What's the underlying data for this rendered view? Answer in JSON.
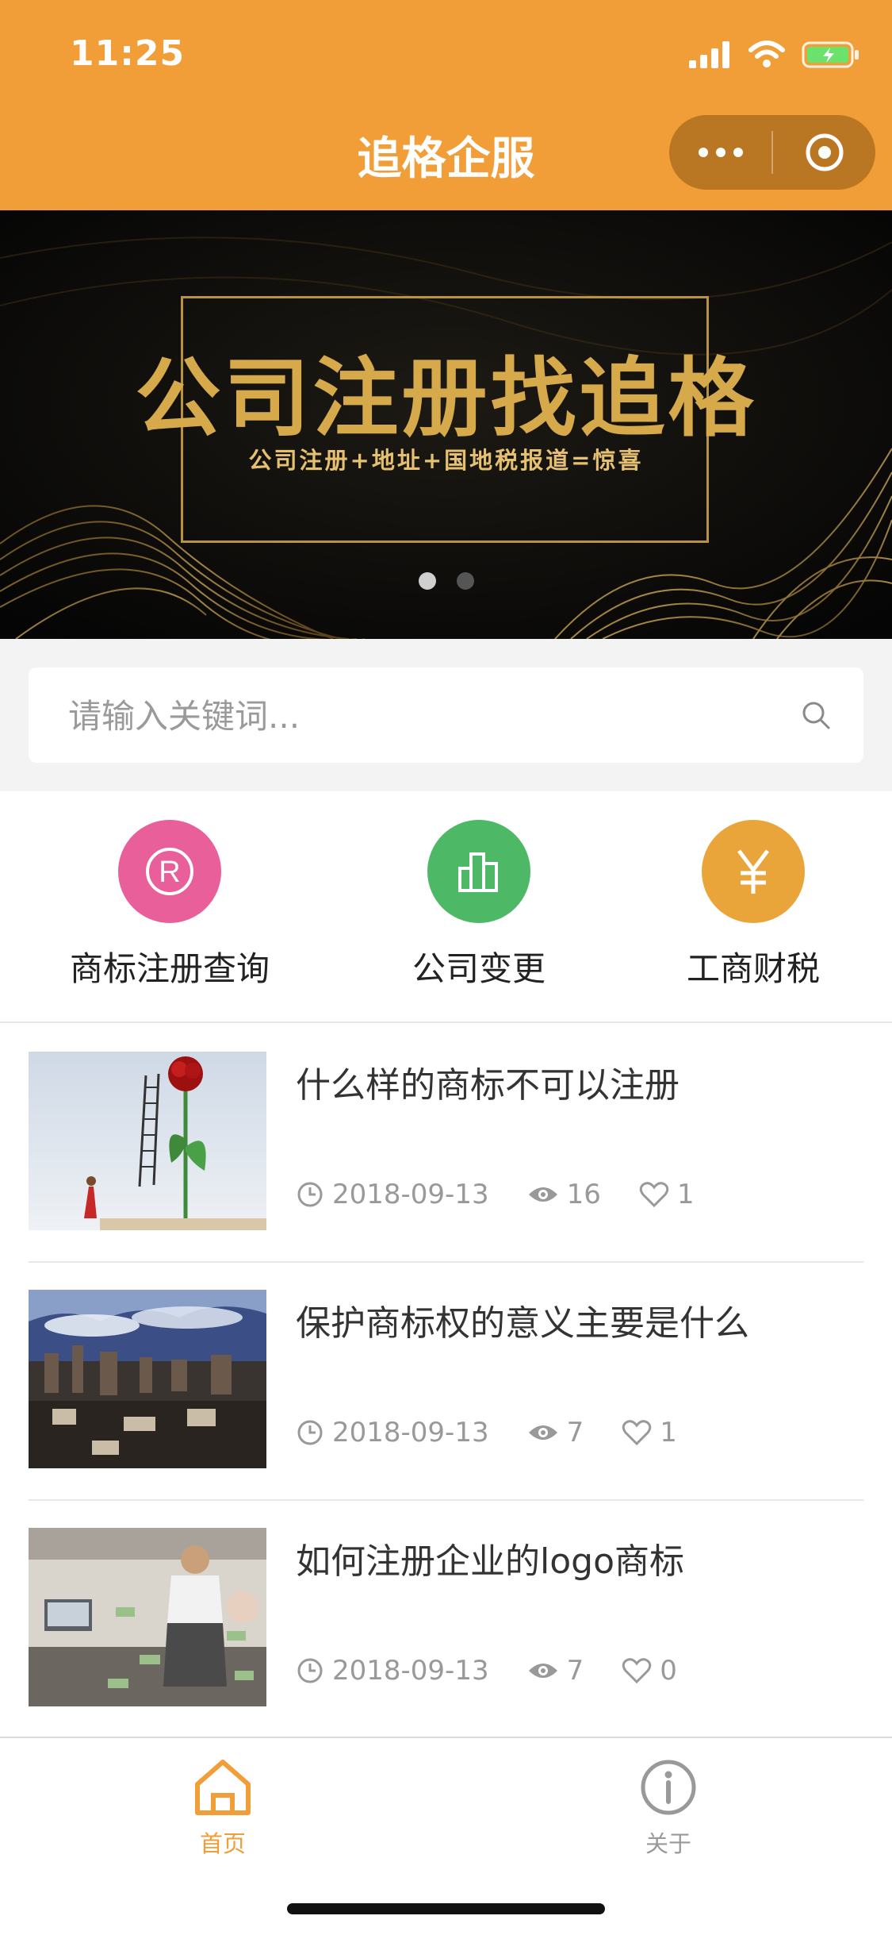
{
  "status_bar": {
    "time": "11:25"
  },
  "nav": {
    "title": "追格企服"
  },
  "banner": {
    "title": "公司注册找追格",
    "subtitle": "公司注册+地址+国地税报道=惊喜",
    "dots_total": 2,
    "dots_active": 1
  },
  "search": {
    "placeholder": "请输入关键词..."
  },
  "quick_entries": [
    {
      "label": "商标注册查询",
      "icon": "registered-trademark-icon",
      "color": "#E95F9A"
    },
    {
      "label": "公司变更",
      "icon": "bar-chart-icon",
      "color": "#4DB866"
    },
    {
      "label": "工商财税",
      "icon": "yen-icon",
      "color": "#E9A43A"
    }
  ],
  "articles": [
    {
      "title": "什么样的商标不可以注册",
      "date": "2018-09-13",
      "views": "16",
      "likes": "1"
    },
    {
      "title": "保护商标权的意义主要是什么",
      "date": "2018-09-13",
      "views": "7",
      "likes": "1"
    },
    {
      "title": "如何注册企业的logo商标",
      "date": "2018-09-13",
      "views": "7",
      "likes": "0"
    }
  ],
  "tabbar": [
    {
      "label": "首页",
      "active": true,
      "color": "#F19E38"
    },
    {
      "label": "关于",
      "active": false,
      "color": "#999999"
    }
  ],
  "colors": {
    "brand": "#F19E38",
    "banner_gold": "#D6A94A"
  }
}
